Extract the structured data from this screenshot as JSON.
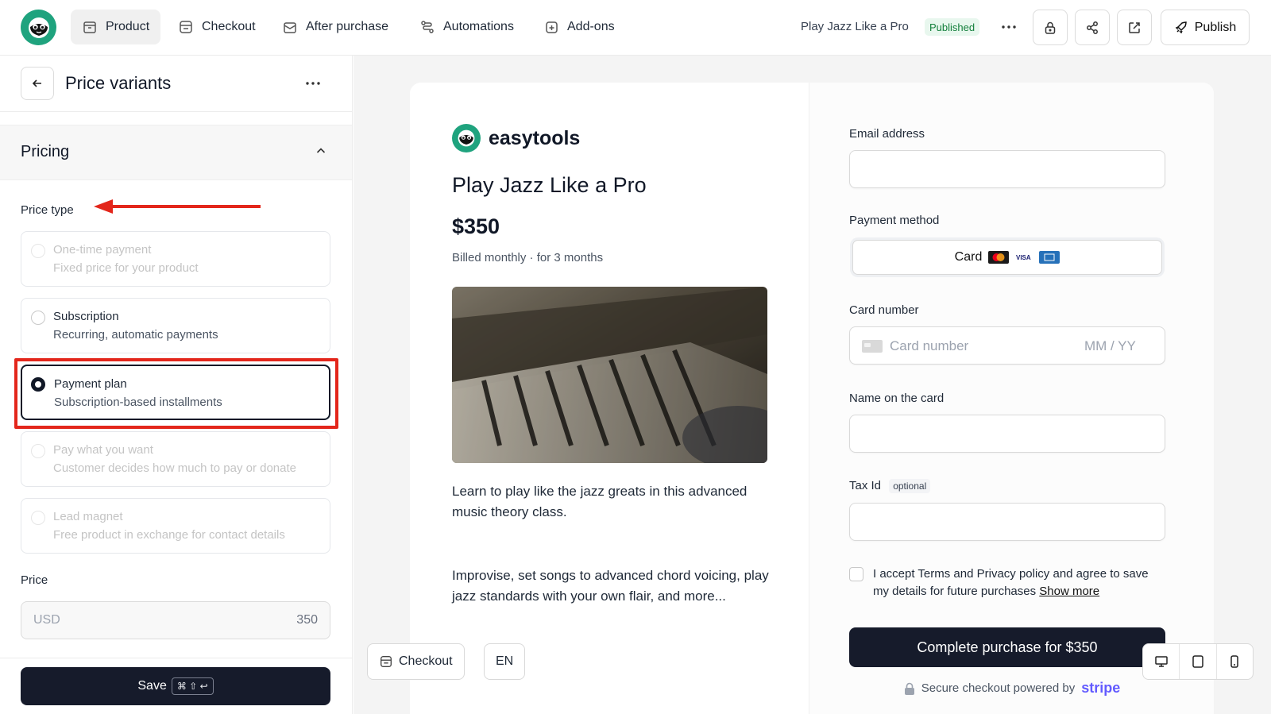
{
  "nav": {
    "tabs": [
      {
        "label": "Product",
        "icon": "box-icon"
      },
      {
        "label": "Checkout",
        "icon": "checkout-icon"
      },
      {
        "label": "After purchase",
        "icon": "mail-icon"
      },
      {
        "label": "Automations",
        "icon": "automation-icon"
      },
      {
        "label": "Add-ons",
        "icon": "plus-square-icon"
      }
    ],
    "product_title": "Play Jazz Like a Pro",
    "status": "Published",
    "publish_label": "Publish"
  },
  "panel": {
    "title": "Price variants",
    "section_title": "Pricing",
    "price_type_label": "Price type",
    "options": [
      {
        "title": "One-time payment",
        "subtitle": "Fixed price for your product",
        "state": "disabled"
      },
      {
        "title": "Subscription",
        "subtitle": "Recurring, automatic payments",
        "state": "enabled"
      },
      {
        "title": "Payment plan",
        "subtitle": "Subscription-based installments",
        "state": "selected"
      },
      {
        "title": "Pay what you want",
        "subtitle": "Customer decides how much to pay or donate",
        "state": "disabled"
      },
      {
        "title": "Lead magnet",
        "subtitle": "Free product in exchange for contact details",
        "state": "disabled"
      }
    ],
    "price_label": "Price",
    "price_currency": "USD",
    "price_value": "350",
    "save_label": "Save",
    "save_shortcut": "⌘ ⇧ ↩"
  },
  "preview": {
    "brand": "easytools",
    "product_title": "Play Jazz Like a Pro",
    "price": "$350",
    "billing": "Billed monthly · for 3 months",
    "description_1": "Learn to play like the jazz greats in this advanced music theory class.",
    "description_2": "Improvise, set songs to advanced chord voicing, play jazz standards with your own flair, and more...",
    "email_label": "Email address",
    "payment_method_label": "Payment method",
    "payment_method_value": "Card",
    "card_number_label": "Card number",
    "card_number_placeholder": "Card number",
    "expiry_placeholder": "MM / YY",
    "name_label": "Name on the card",
    "tax_label": "Tax Id",
    "tax_optional": "optional",
    "accept_text": "I accept Terms and Privacy policy and agree to save my details for future purchases",
    "show_more": "Show more",
    "purchase_button": "Complete purchase for $350",
    "secure_text": "Secure checkout powered by",
    "stripe": "stripe",
    "checkout_toggle": "Checkout",
    "language": "EN"
  },
  "colors": {
    "brand_green": "#1fa37e",
    "dark_button": "#161b2b",
    "annotation_red": "#e3261b",
    "published_green": "#15803d",
    "stripe_purple": "#635bff"
  }
}
